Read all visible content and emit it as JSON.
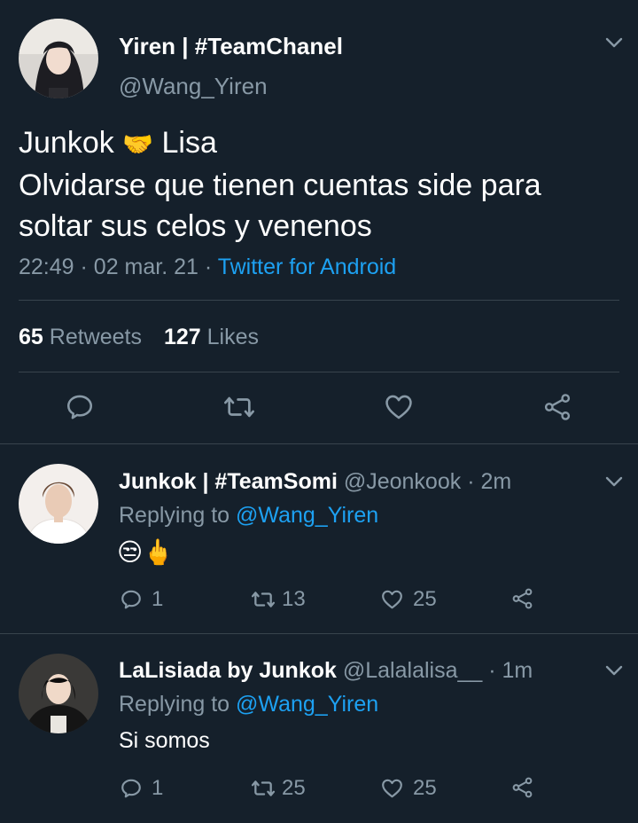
{
  "main_tweet": {
    "display_name": "Yiren | #TeamChanel",
    "handle": "@Wang_Yiren",
    "text_line1_a": "Junkok",
    "text_line1_emoji": "🤝",
    "text_line1_b": "Lisa",
    "text_line2": "Olvidarse que tienen cuentas side para",
    "text_line3": "soltar sus celos y venenos",
    "time": "22:49",
    "sep1": "·",
    "date": "02 mar. 21",
    "sep2": "·",
    "source": "Twitter for Android",
    "retweets_count": "65",
    "retweets_label": "Retweets",
    "likes_count": "127",
    "likes_label": "Likes"
  },
  "replies": [
    {
      "display_name": "Junkok | #TeamSomi",
      "handle": "@Jeonkook",
      "sep": "·",
      "age": "2m",
      "replying_prefix": "Replying to",
      "replying_to": "@Wang_Yiren",
      "text": "😒🖕",
      "reply_count": "1",
      "retweet_count": "13",
      "like_count": "25"
    },
    {
      "display_name": "LaLisiada by Junkok",
      "handle": "@Lalalalisa__",
      "sep": "·",
      "age": "1m",
      "replying_prefix": "Replying to",
      "replying_to": "@Wang_Yiren",
      "text": "Si somos",
      "reply_count": "1",
      "retweet_count": "25",
      "like_count": "25"
    }
  ],
  "icons": [
    "chevron-down-icon",
    "reply-icon",
    "retweet-icon",
    "like-icon",
    "share-icon"
  ],
  "colors": {
    "background": "#15202b",
    "divider": "#38444d",
    "muted": "#8899a6",
    "accent": "#1da1f2"
  }
}
